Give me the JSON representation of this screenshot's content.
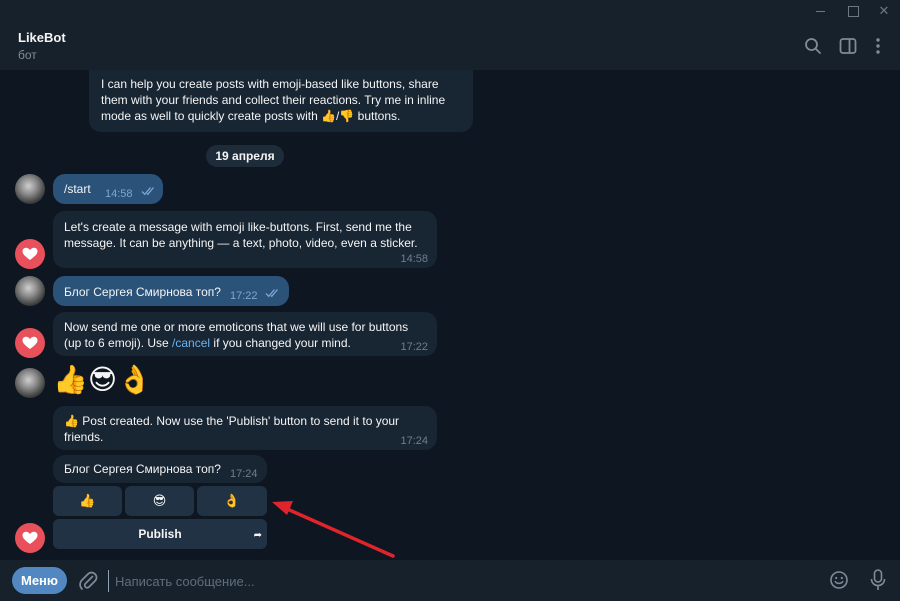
{
  "window": {
    "minimize": "—",
    "maximize": "☐",
    "close": "✕"
  },
  "header": {
    "title": "LikeBot",
    "subtitle": "бот"
  },
  "messages": {
    "intro": {
      "text": "I can help you create posts with emoji-based like buttons, share them with your friends and collect their reactions. Try me in inline mode as well to quickly create posts with 👍/👎 buttons."
    },
    "date": "19 апреля",
    "m1": {
      "text": "/start",
      "time": "14:58"
    },
    "m2": {
      "text": "Let's create a message with emoji like-buttons. First, send me the message. It can be anything — a text, photo, video, even a sticker.",
      "time": "14:58"
    },
    "m3": {
      "text": "Блог Сергея Смирнова топ?",
      "time": "17:22"
    },
    "m4": {
      "text_before": "Now send me one or more emoticons that we will use for buttons (up to 6 emoji). Use ",
      "link": "/cancel",
      "text_after": " if you changed your mind.",
      "time": "17:22"
    },
    "m5": {
      "emojis": "👍😎👌"
    },
    "m6": {
      "text": "👍 Post created. Now use the 'Publish' button to send it to your friends.",
      "time": "17:24"
    },
    "m7": {
      "text": "Блог Сергея Смирнова топ?",
      "time": "17:24"
    }
  },
  "keyboard": {
    "buttons": [
      "👍",
      "😎",
      "👌"
    ],
    "publish": "Publish",
    "share_icon": "➦"
  },
  "input": {
    "menu_label": "Меню",
    "placeholder": "Написать сообщение..."
  },
  "colors": {
    "background": "#0e1621",
    "bubble_in": "#182533",
    "bubble_out": "#2b5278",
    "accent": "#5288c1",
    "bot_avatar": "#e8505b",
    "arrow": "#e0242b"
  }
}
